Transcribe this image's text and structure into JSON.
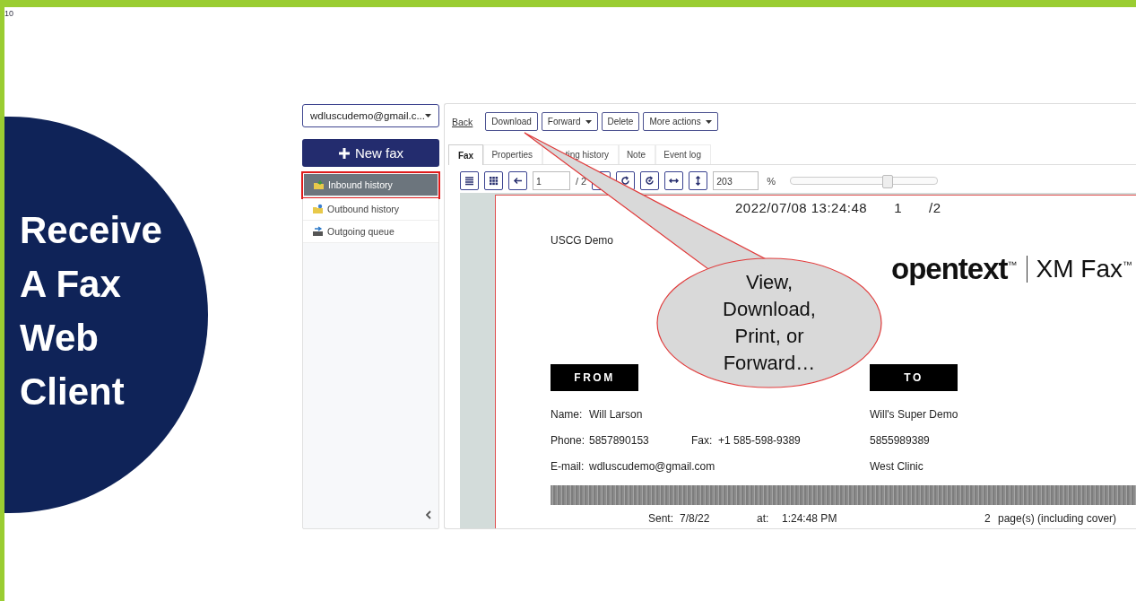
{
  "slide": {
    "page_number": "10",
    "heading": "Receive\nA Fax\nWeb\nClient",
    "callout": "View,\nDownload,\nPrint, or\nForward…"
  },
  "sidebar": {
    "account": "wdluscudemo@gmail.c...",
    "new_fax": "New fax",
    "items": [
      {
        "label": "Inbound history",
        "selected": true
      },
      {
        "label": "Outbound history",
        "selected": false
      },
      {
        "label": "Outgoing queue",
        "selected": false
      }
    ]
  },
  "toolbar": {
    "back": "Back",
    "buttons": [
      {
        "label": "Download",
        "dropdown": false
      },
      {
        "label": "Forward",
        "dropdown": true
      },
      {
        "label": "Delete",
        "dropdown": false
      },
      {
        "label": "More actions",
        "dropdown": true
      }
    ]
  },
  "tabs": [
    {
      "label": "Fax",
      "selected": true
    },
    {
      "label": "Properties",
      "selected": false
    },
    {
      "label": "ting history",
      "selected": false
    },
    {
      "label": "Note",
      "selected": false
    },
    {
      "label": "Event log",
      "selected": false
    }
  ],
  "viewer": {
    "page": "1",
    "page_count": "/ 2",
    "zoom": "203",
    "percent": "%",
    "zoom_slider": {
      "level": 0.66
    }
  },
  "document": {
    "timestamp": "2022/07/08 13:24:48",
    "page": "1",
    "pages": "/2",
    "sender": "USCG Demo",
    "brand": "opentext$^{™}$",
    "product": "XM Fax$^{™}$",
    "from_heading": "FROM",
    "to_heading": "TO",
    "from": [
      {
        "label": "Name:",
        "value": "Will Larson"
      },
      {
        "label": "Phone:",
        "value": "5857890153",
        "extra_label": "Fax:",
        "extra_value": "+1 585-598-9389"
      },
      {
        "label": "E-mail:",
        "value": "wdluscudemo@gmail.com"
      }
    ],
    "to": [
      "Will's Super Demo",
      "5855989389",
      "West Clinic"
    ],
    "sent": {
      "sent_label": "Sent:",
      "date": "7/8/22",
      "at_label": "at:",
      "time": "1:24:48 PM",
      "pages": "2",
      "pages_label": "page(s) (including cover)"
    }
  }
}
